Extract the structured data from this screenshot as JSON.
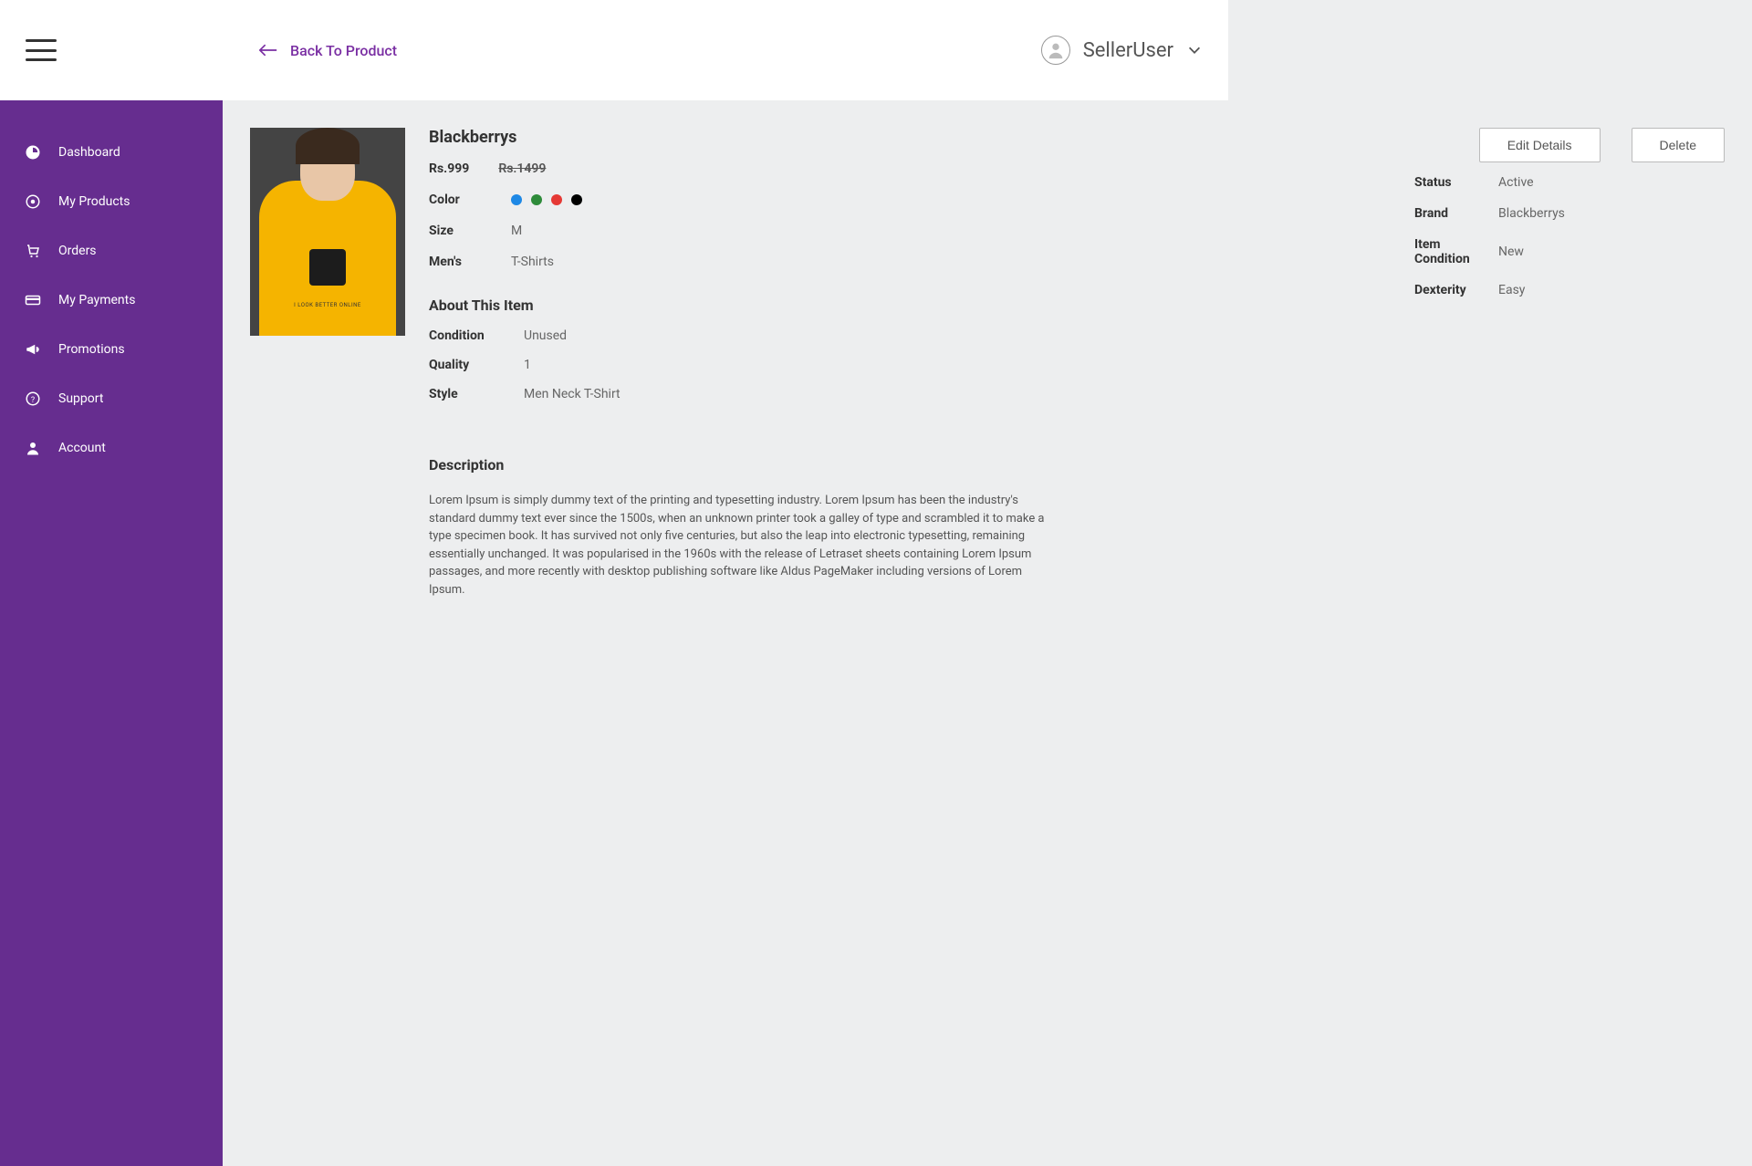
{
  "header": {
    "back_label": "Back To Product",
    "user_name": "SellerUser"
  },
  "sidebar": {
    "items": [
      {
        "label": "Dashboard",
        "icon": "dashboard-icon"
      },
      {
        "label": "My Products",
        "icon": "products-icon"
      },
      {
        "label": "Orders",
        "icon": "orders-icon"
      },
      {
        "label": "My Payments",
        "icon": "payments-icon"
      },
      {
        "label": "Promotions",
        "icon": "promotions-icon"
      },
      {
        "label": "Support",
        "icon": "support-icon"
      },
      {
        "label": "Account",
        "icon": "account-icon"
      }
    ]
  },
  "actions": {
    "edit_label": "Edit Details",
    "delete_label": "Delete"
  },
  "product": {
    "title": "Blackberrys",
    "price_current": "Rs.999",
    "price_old": "Rs.1499",
    "labels": {
      "color": "Color",
      "size": "Size",
      "category": "Men's"
    },
    "values": {
      "size": "M",
      "category": "T-Shirts"
    },
    "colors": [
      "#1e88e5",
      "#2e8b3a",
      "#e53935",
      "#000000"
    ],
    "meta": {
      "labels": {
        "status": "Status",
        "brand": "Brand",
        "condition": "Item Condition",
        "dexterity": "Dexterity"
      },
      "values": {
        "status": "Active",
        "brand": "Blackberrys",
        "condition": "New",
        "dexterity": "Easy"
      }
    },
    "image_caption": "I LOOK BETTER ONLINE"
  },
  "about": {
    "heading": "About This Item",
    "labels": {
      "condition": "Condition",
      "quality": "Quality",
      "style": "Style"
    },
    "values": {
      "condition": "Unused",
      "quality": "1",
      "style": "Men Neck T-Shirt"
    }
  },
  "description": {
    "heading": "Description",
    "text": "Lorem Ipsum is simply dummy text of the printing and typesetting industry. Lorem Ipsum has been the industry's standard dummy text ever since the 1500s, when an unknown printer took a galley of type and scrambled it to make a type specimen book. It has survived not only five centuries, but also the leap into electronic typesetting, remaining essentially unchanged. It was popularised in the 1960s with the release of Letraset sheets containing Lorem Ipsum passages, and more recently with desktop publishing software like Aldus PageMaker including versions of Lorem Ipsum."
  }
}
